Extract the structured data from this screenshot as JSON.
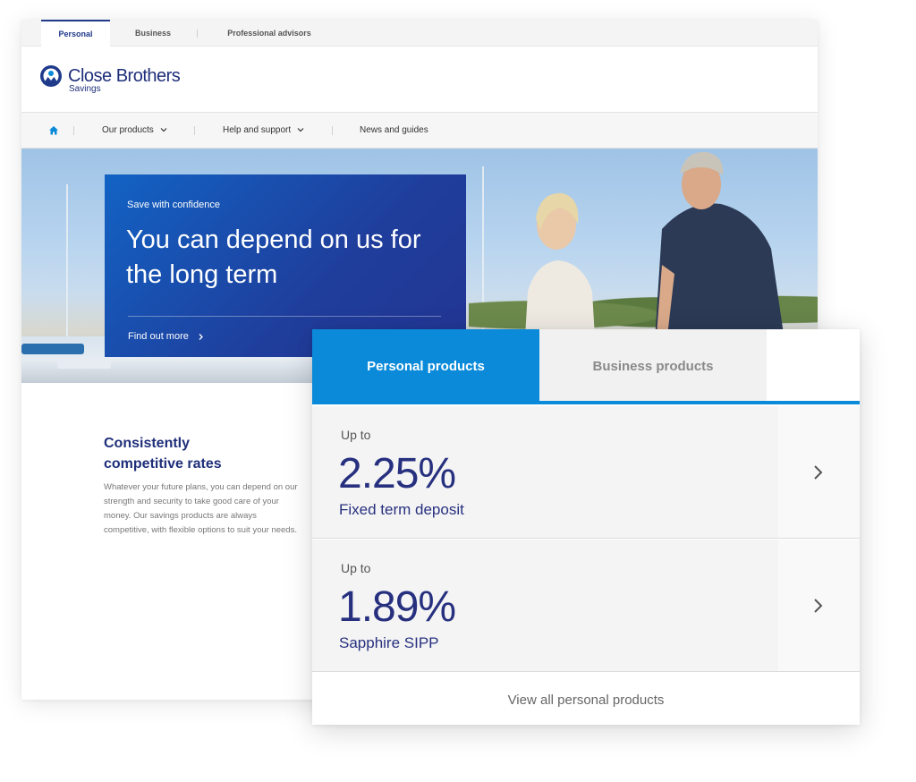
{
  "top_tabs": [
    "Personal",
    "Business",
    "Professional advisors"
  ],
  "logo": {
    "name": "Close Brothers",
    "sub": "Savings"
  },
  "nav": {
    "home_icon": "home-icon",
    "items": [
      {
        "label": "Our products",
        "has_chevron": true
      },
      {
        "label": "Help and support",
        "has_chevron": true
      },
      {
        "label": "News and guides",
        "has_chevron": false
      }
    ]
  },
  "hero": {
    "eyebrow": "Save with confidence",
    "title": "You can depend on us for the long term",
    "link": "Find out more"
  },
  "intro": {
    "heading": "Consistently competitive rates",
    "body": "Whatever your future plans, you can depend on our strength and security to take good care of your money. Our savings products are always competitive, with flexible options to suit your needs."
  },
  "panel": {
    "tabs": [
      "Personal products",
      "Business products"
    ],
    "active_tab": "Personal products",
    "rates": [
      {
        "prefix": "Up to",
        "rate": "2.25%",
        "product": "Fixed term deposit"
      },
      {
        "prefix": "Up to",
        "rate": "1.89%",
        "product": "Sapphire SIPP"
      }
    ],
    "view_all": "View all personal products"
  },
  "colors": {
    "brand_navy": "#1f2f7a",
    "brand_blue": "#0a8ad9",
    "rate_text": "#27307f"
  }
}
